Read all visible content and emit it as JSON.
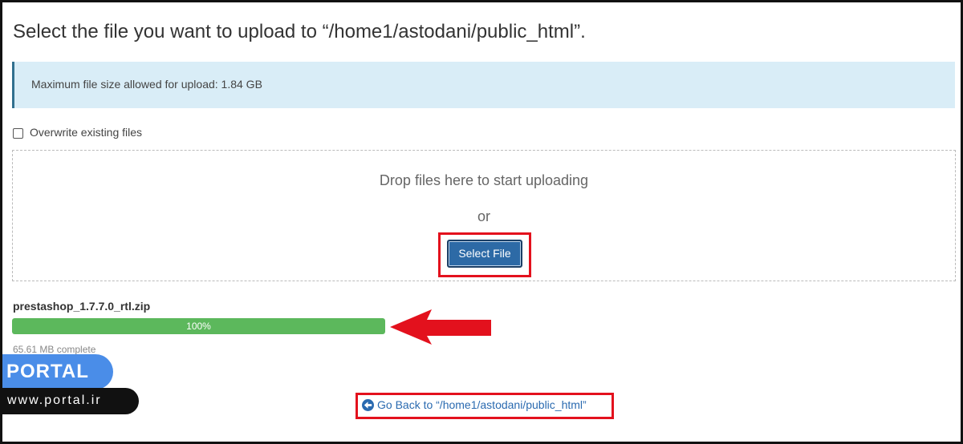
{
  "page": {
    "title": "Select the file you want to upload to “/home1/astodani/public_html”."
  },
  "info": {
    "max_size_text": "Maximum file size allowed for upload: 1.84 GB"
  },
  "options": {
    "overwrite_label": "Overwrite existing files",
    "overwrite_checked": false
  },
  "dropzone": {
    "drop_text": "Drop files here to start uploading",
    "or_text": "or",
    "select_button_label": "Select File"
  },
  "upload": {
    "file_name": "prestashop_1.7.7.0_rtl.zip",
    "progress_percent": 100,
    "progress_label": "100%",
    "complete_text": "65.61 MB complete"
  },
  "footer": {
    "back_link_label": "Go Back to “/home1/astodani/public_html”"
  },
  "watermark": {
    "brand": "PORTAL",
    "site": "www.portal.ir"
  },
  "colors": {
    "info_bg": "#d9edf7",
    "progress": "#5cb85c",
    "button": "#2d6aa6",
    "highlight": "#e3111d",
    "link": "#2a6ab0",
    "brand_blue": "#4a8de8"
  },
  "icons": {
    "back": "arrow-circle-left-icon",
    "annotation": "red-arrow-left-icon"
  }
}
